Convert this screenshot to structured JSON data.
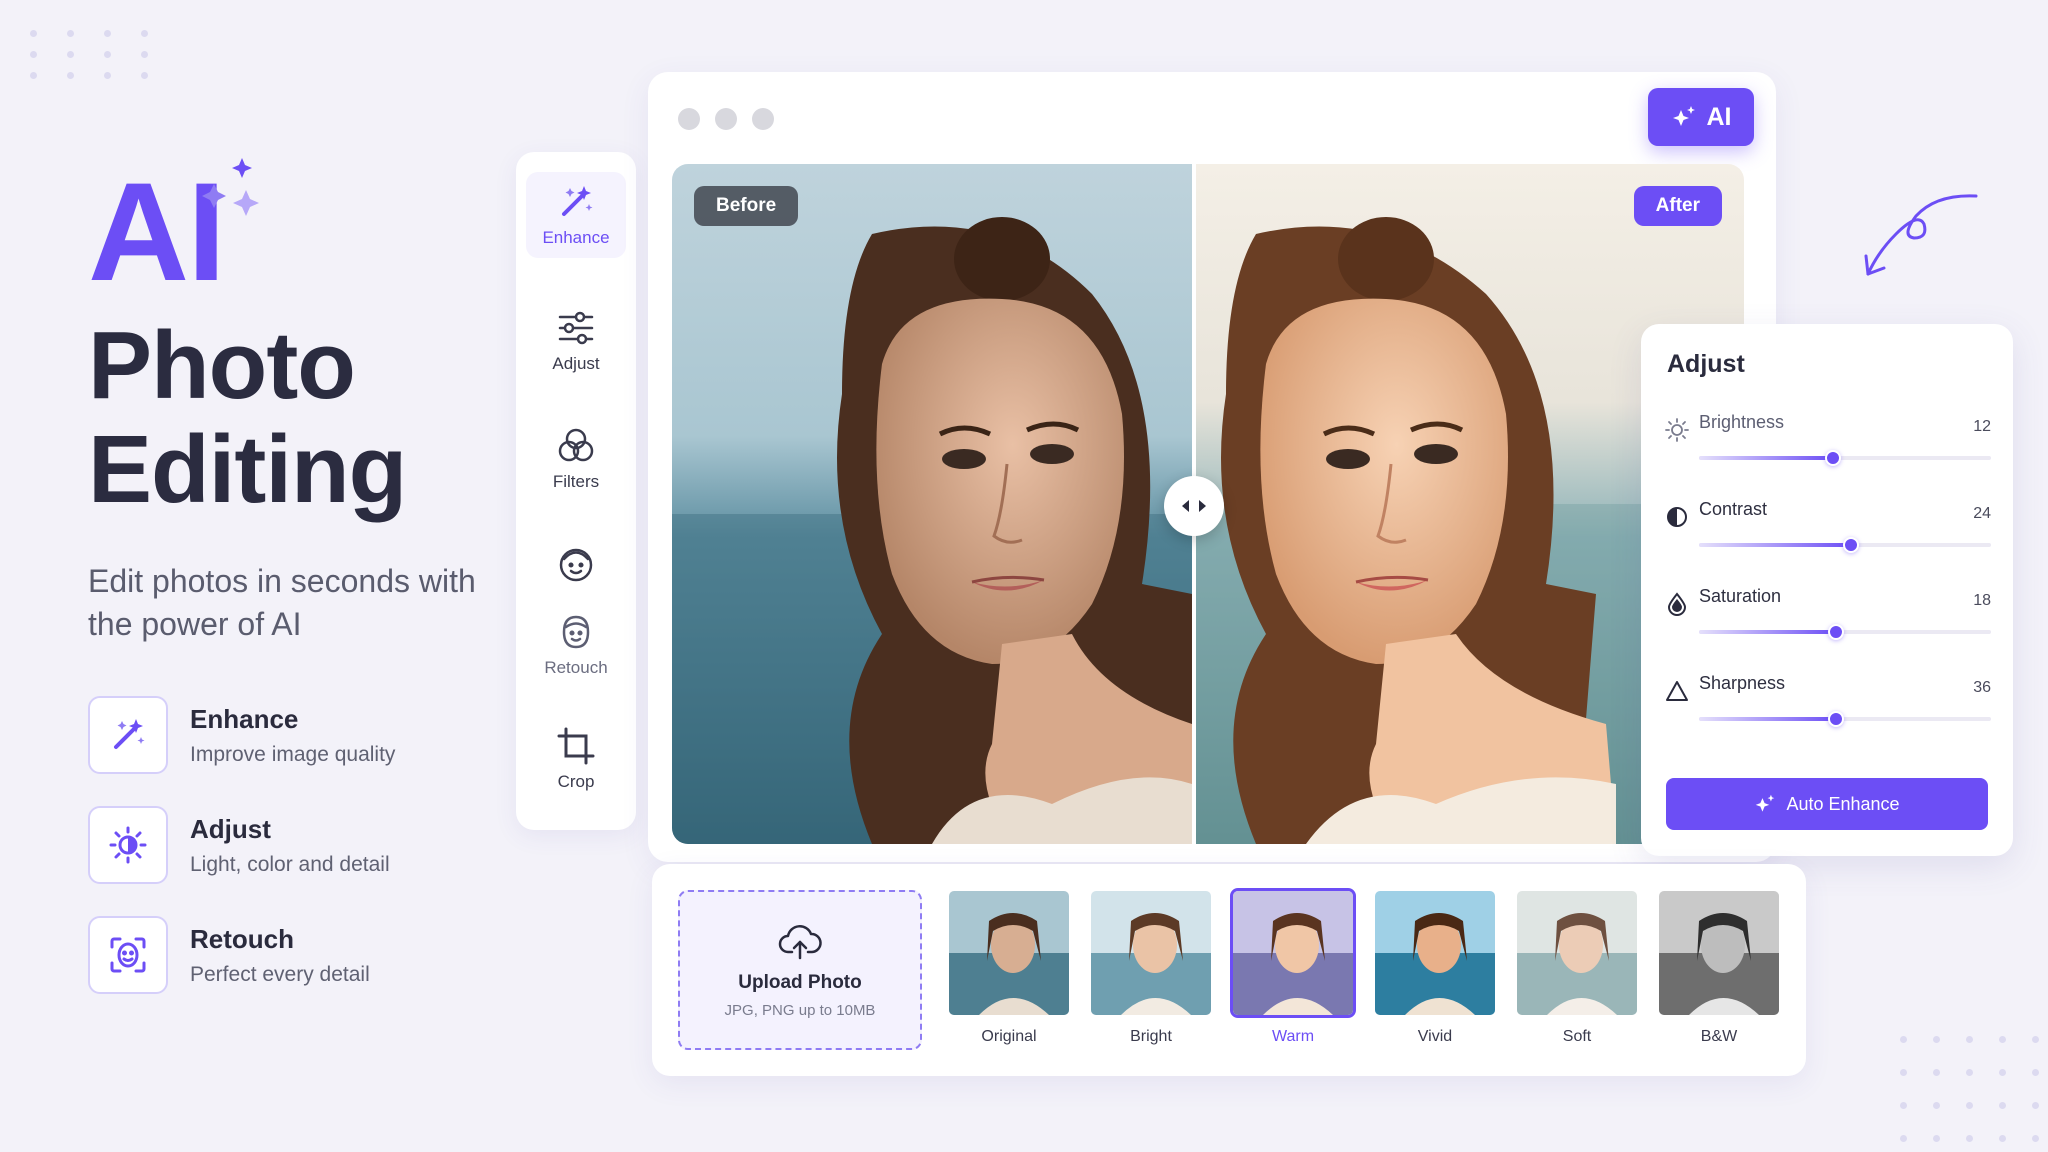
{
  "hero": {
    "ai": "AI",
    "title_line1": "Photo",
    "title_line2": "Editing",
    "subtitle": "Edit photos in seconds with the power of AI",
    "features": [
      {
        "name": "Enhance",
        "desc": "Improve image quality",
        "icon": "magic-wand-icon"
      },
      {
        "name": "Adjust",
        "desc": "Light, color and detail",
        "icon": "brightness-icon"
      },
      {
        "name": "Retouch",
        "desc": "Perfect every detail",
        "icon": "face-scan-icon"
      }
    ]
  },
  "toolbar": {
    "items": [
      {
        "label": "Enhance",
        "icon": "magic-wand-icon",
        "active": true
      },
      {
        "label": "Adjust",
        "icon": "sliders-icon"
      },
      {
        "label": "Filters",
        "icon": "filters-icon"
      },
      {
        "label": "",
        "icon": "face-icon"
      },
      {
        "label": "Retouch",
        "icon": "retouch-icon"
      },
      {
        "label": "Crop",
        "icon": "crop-icon"
      }
    ]
  },
  "editor": {
    "ai_button": "AI",
    "before_label": "Before",
    "after_label": "After"
  },
  "adjust": {
    "title": "Adjust",
    "sliders": [
      {
        "label": "Brightness",
        "value": "12",
        "level": 0.46,
        "icon": "sun-icon"
      },
      {
        "label": "Contrast",
        "value": "24",
        "level": 0.52,
        "icon": "contrast-icon"
      },
      {
        "label": "Saturation",
        "value": "18",
        "level": 0.47,
        "icon": "saturation-drop-icon"
      },
      {
        "label": "Sharpness",
        "value": "36",
        "level": 0.47,
        "icon": "sharpness-triangle-icon"
      }
    ],
    "auto_button": "Auto Enhance"
  },
  "strip": {
    "upload_title": "Upload Photo",
    "upload_sub": "JPG, PNG up to 10MB",
    "filters": [
      {
        "label": "Original"
      },
      {
        "label": "Bright"
      },
      {
        "label": "Warm",
        "selected": true
      },
      {
        "label": "Vivid"
      },
      {
        "label": "Soft"
      },
      {
        "label": "B&W"
      }
    ]
  },
  "colors": {
    "accent": "#6c4ef5",
    "background": "#f3f2f9",
    "text_dark": "#2b2c40"
  }
}
